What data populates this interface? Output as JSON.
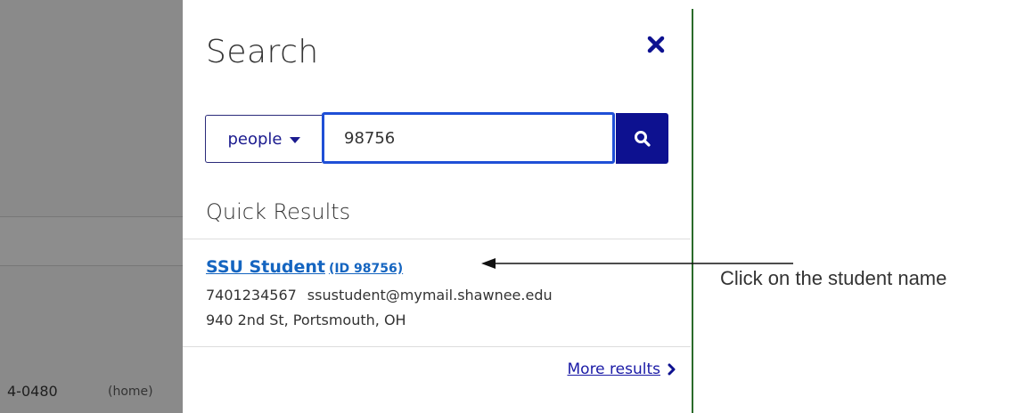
{
  "background": {
    "phone_fragment": "4-0480",
    "phone_type": "(home)"
  },
  "search_panel": {
    "title": "Search",
    "scope_label": "people",
    "query_value": "98756",
    "quick_results_title": "Quick Results",
    "result": {
      "name": "SSU Student",
      "id_label": "(ID 98756)",
      "phone": "7401234567",
      "email": "ssustudent@mymail.shawnee.edu",
      "address": "940 2nd St, Portsmouth, OH"
    },
    "more_results_label": "More results"
  },
  "annotation": {
    "text": "Click on the student name"
  },
  "colors": {
    "accent_blue": "#0d1190",
    "link_blue": "#1565c0",
    "input_border": "#1f4fd6",
    "overlay_gray": "#8a8a8a",
    "divider_green": "#2b6b2b"
  },
  "icons": {
    "close": "close-icon",
    "search": "search-icon",
    "caret": "caret-down-icon",
    "more": "chevron-right-icon",
    "arrow": "arrow-left-icon"
  }
}
